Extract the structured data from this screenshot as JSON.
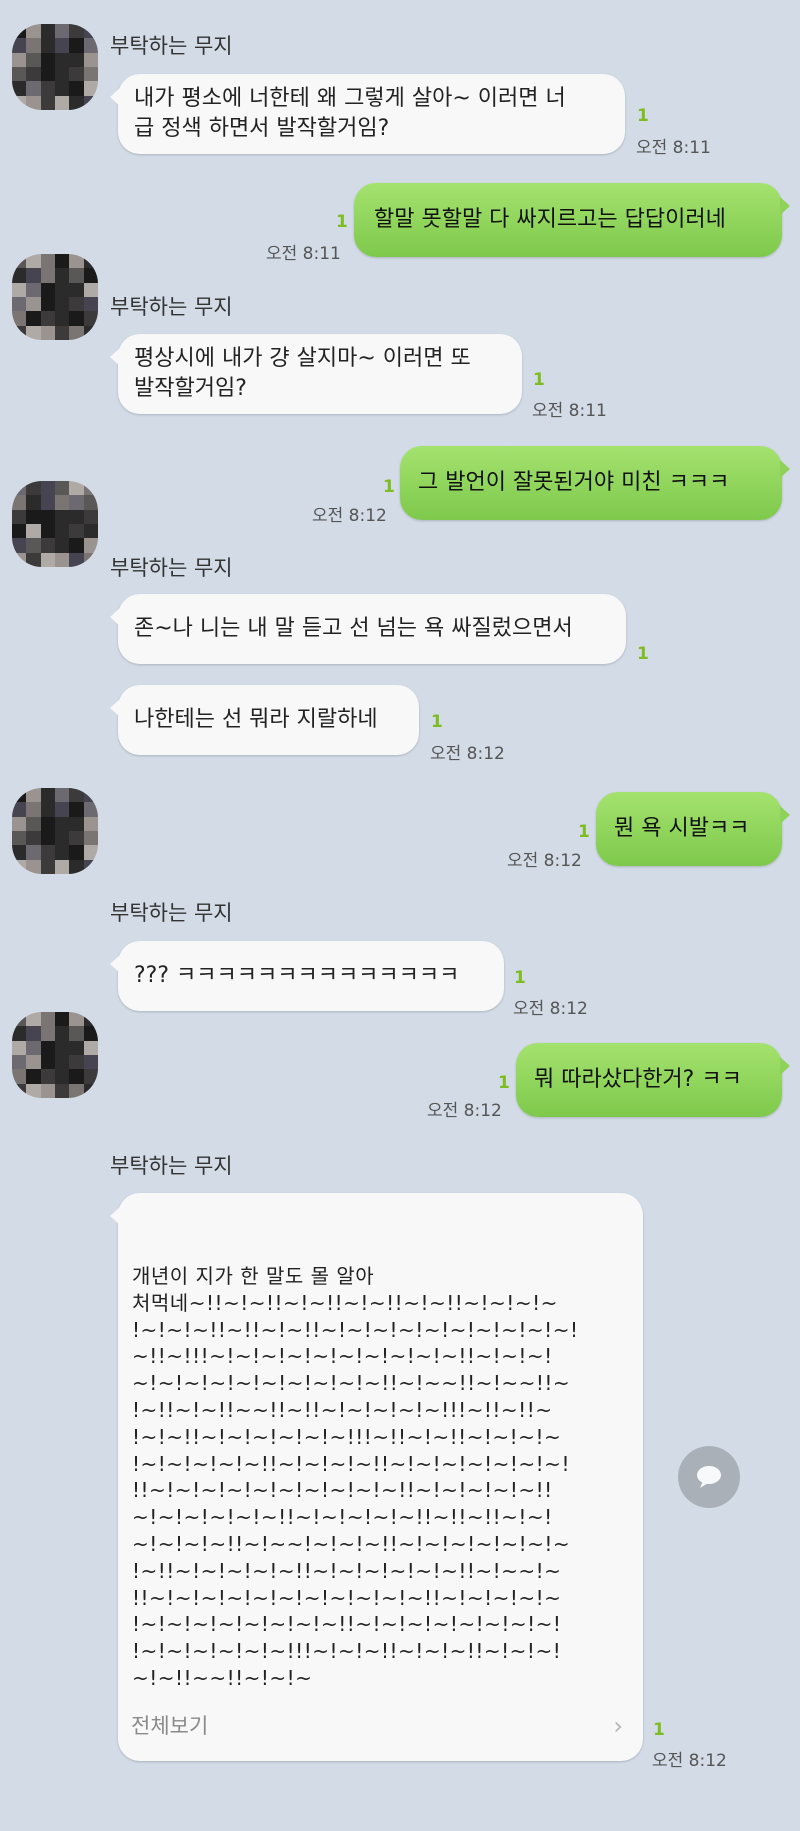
{
  "sender_name": "부탁하는 무지",
  "messages": [
    {
      "text": "내가 평소에 너한테 왜 그렇게 살아~ 이러면 너\n급 정색 하면서 발작할거임?",
      "unread": "1",
      "time": "오전 8:11"
    },
    {
      "text": "할말 못할말 다 싸지르고는 답답이러네",
      "unread": "1",
      "time": "오전 8:11"
    },
    {
      "text": "평상시에 내가 걍 살지마~ 이러면 또\n발작할거임?",
      "unread": "1",
      "time": "오전 8:11"
    },
    {
      "text": "그 발언이 잘못된거야 미친 ㅋㅋㅋ",
      "unread": "1",
      "time": "오전 8:12"
    },
    {
      "text": "존~나 니는 내 말 듣고 선 넘는 욕 싸질렀으면서",
      "unread": "1",
      "time": ""
    },
    {
      "text": "나한테는 선 뭐라 지랄하네",
      "unread": "1",
      "time": "오전 8:12"
    },
    {
      "text": "뭔 욕 시발ㅋㅋ",
      "unread": "1",
      "time": "오전 8:12"
    },
    {
      "text": "??? ㅋㅋㅋㅋㅋㅋㅋㅋㅋㅋㅋㅋㅋㅋ",
      "unread": "1",
      "time": "오전 8:12"
    },
    {
      "text": "뭐 따라샀다한거? ㅋㅋ",
      "unread": "1",
      "time": "오전 8:12"
    },
    {
      "text": "개년이 지가 한 말도 몰 알아\n처먹네~!!~!~!!~!~!!~!~!!~!~!!~!~!~!~\n!~!~!~!!~!!~!~!!~!~!~!~!~!~!~!~!~!~!\n~!!~!!!~!~!~!~!~!~!~!~!~!~!!~!~!~!\n~!~!~!~!~!~!~!~!~!~!!~!~~!!~!~~!!~\n!~!!~!~!!~~!!~!!~!~!~!~!~!!!~!!~!!~\n!~!~!!~!~!~!~!~!~!!!~!!~!~!!~!~!~!~\n!~!~!~!~!~!!~!~!~!~!!~!~!~!~!~!~!~!\n!!~!~!~!~!~!~!~!~!~!~!!~!~!~!~!~!!\n~!~!~!~!~!~!!~!~!~!~!~!!~!!~!!~!~!\n~!~!~!~!!~!~~!~!~!~!!~!~!~!~!~!~!~\n!~!!~!~!~!~!~!!~!~!~!~!~!~!!~!~~!~\n!!~!~!~!~!~!~!~!~!~!~!~!!~!~!~!~!~\n!~!~!~!~!~!~!~!~!!~!~!~!~!~!~!~!~!\n!~!~!~!~!~!~!!!~!~!~!!~!~!~!!~!~!~!\n~!~!!~~!!~!~!~",
      "unread": "1",
      "time": "오전 8:12"
    }
  ],
  "view_all_label": "전체보기",
  "colors": {
    "background": "#d2dbe6",
    "outgoing": "#8dd65a",
    "incoming": "#f8f8f8",
    "unread": "#7dbd1f"
  },
  "icons": {
    "fab": "chat-bubble-icon",
    "chevron": "chevron-right-icon"
  }
}
